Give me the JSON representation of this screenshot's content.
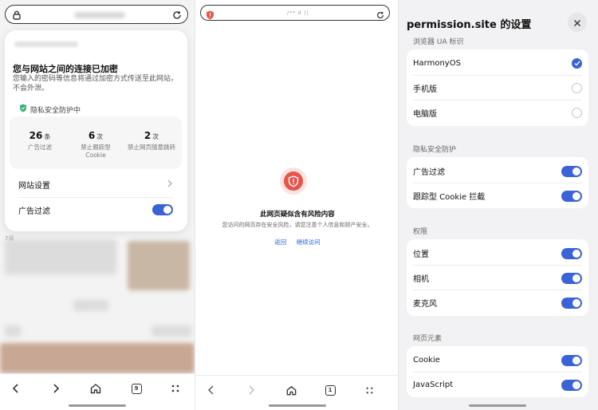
{
  "panel1": {
    "popover": {
      "title": "您与网站之间的连接已加密",
      "description": "您输入的密码等信息将通过加密方式传送至此网站，不会外泄。",
      "privacy_status": "隐私安全防护中",
      "stats": [
        {
          "number": "26",
          "unit": "条",
          "label": "广告过滤"
        },
        {
          "number": "6",
          "unit": "次",
          "label": "禁止跟踪型 Cookie"
        },
        {
          "number": "2",
          "unit": "次",
          "label": "禁止网页随意跳转"
        }
      ],
      "site_settings_label": "网站设置",
      "ad_filter_label": "广告过滤"
    },
    "background_count": "7评",
    "nav": {
      "tab_count": "9"
    }
  },
  "panel2": {
    "url": "/**.d   ||",
    "warning_title": "此网页疑似含有风险内容",
    "warning_desc": "您访问的网页存在安全风险，请您注意个人信息和财产安全。",
    "back_label": "返回",
    "continue_label": "继续访问",
    "nav": {
      "tab_count": "1"
    }
  },
  "panel3": {
    "title": "permission.site 的设置",
    "sections": [
      {
        "header": "浏览器 UA 标识",
        "items": [
          "HarmonyOS",
          "手机版",
          "电脑版"
        ],
        "selected": 0
      },
      {
        "header": "隐私安全防护",
        "items": [
          "广告过滤",
          "跟踪型 Cookie 拦截"
        ]
      },
      {
        "header": "权限",
        "items": [
          "位置",
          "相机",
          "麦克风"
        ]
      },
      {
        "header": "网页元素",
        "items": [
          "Cookie",
          "JavaScript"
        ]
      }
    ]
  },
  "colors": {
    "accent": "#3a63d8",
    "danger": "#e8544a",
    "privacy_green": "#3bb273"
  }
}
